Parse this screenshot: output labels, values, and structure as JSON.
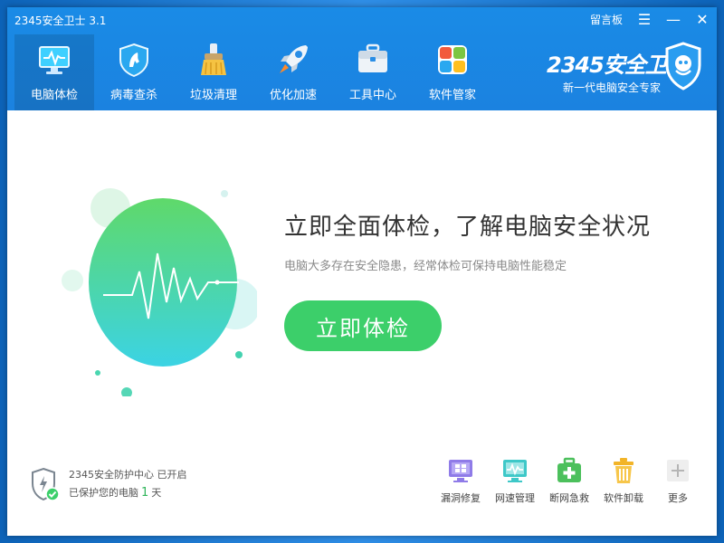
{
  "window": {
    "title": "2345安全卫士 3.1"
  },
  "controls": {
    "feedback_label": "留言板",
    "menu_glyph": "☰",
    "min_glyph": "—",
    "close_glyph": "✕"
  },
  "nav": {
    "items": [
      {
        "label": "电脑体检",
        "icon": "monitor-icon",
        "active": true
      },
      {
        "label": "病毒查杀",
        "icon": "shield-horse-icon",
        "active": false
      },
      {
        "label": "垃圾清理",
        "icon": "broom-icon",
        "active": false
      },
      {
        "label": "优化加速",
        "icon": "rocket-icon",
        "active": false
      },
      {
        "label": "工具中心",
        "icon": "toolbox-icon",
        "active": false
      },
      {
        "label": "软件管家",
        "icon": "windows-grid-icon",
        "active": false
      }
    ]
  },
  "brand": {
    "logo_text": "2345安全卫士",
    "slogan": "新一代电脑安全专家"
  },
  "hero": {
    "title": "立即全面体检，了解电脑安全状况",
    "subtitle": "电脑大多存在安全隐患，经常体检可保持电脑性能稳定",
    "button_label": "立即体检"
  },
  "status": {
    "line1": "2345安全防护中心 已开启",
    "line2_prefix": "已保护您的电脑",
    "days": "1",
    "line2_suffix": "天"
  },
  "tools": [
    {
      "label": "漏洞修复",
      "icon": "windows-monitor-icon"
    },
    {
      "label": "网速管理",
      "icon": "network-monitor-icon"
    },
    {
      "label": "断网急救",
      "icon": "first-aid-kit-icon"
    },
    {
      "label": "软件卸载",
      "icon": "trash-icon"
    },
    {
      "label": "更多",
      "icon": "plus-icon"
    }
  ],
  "colors": {
    "header": "#1b86e3",
    "accent_green": "#3ccf6a",
    "days_green": "#2fb55a"
  }
}
